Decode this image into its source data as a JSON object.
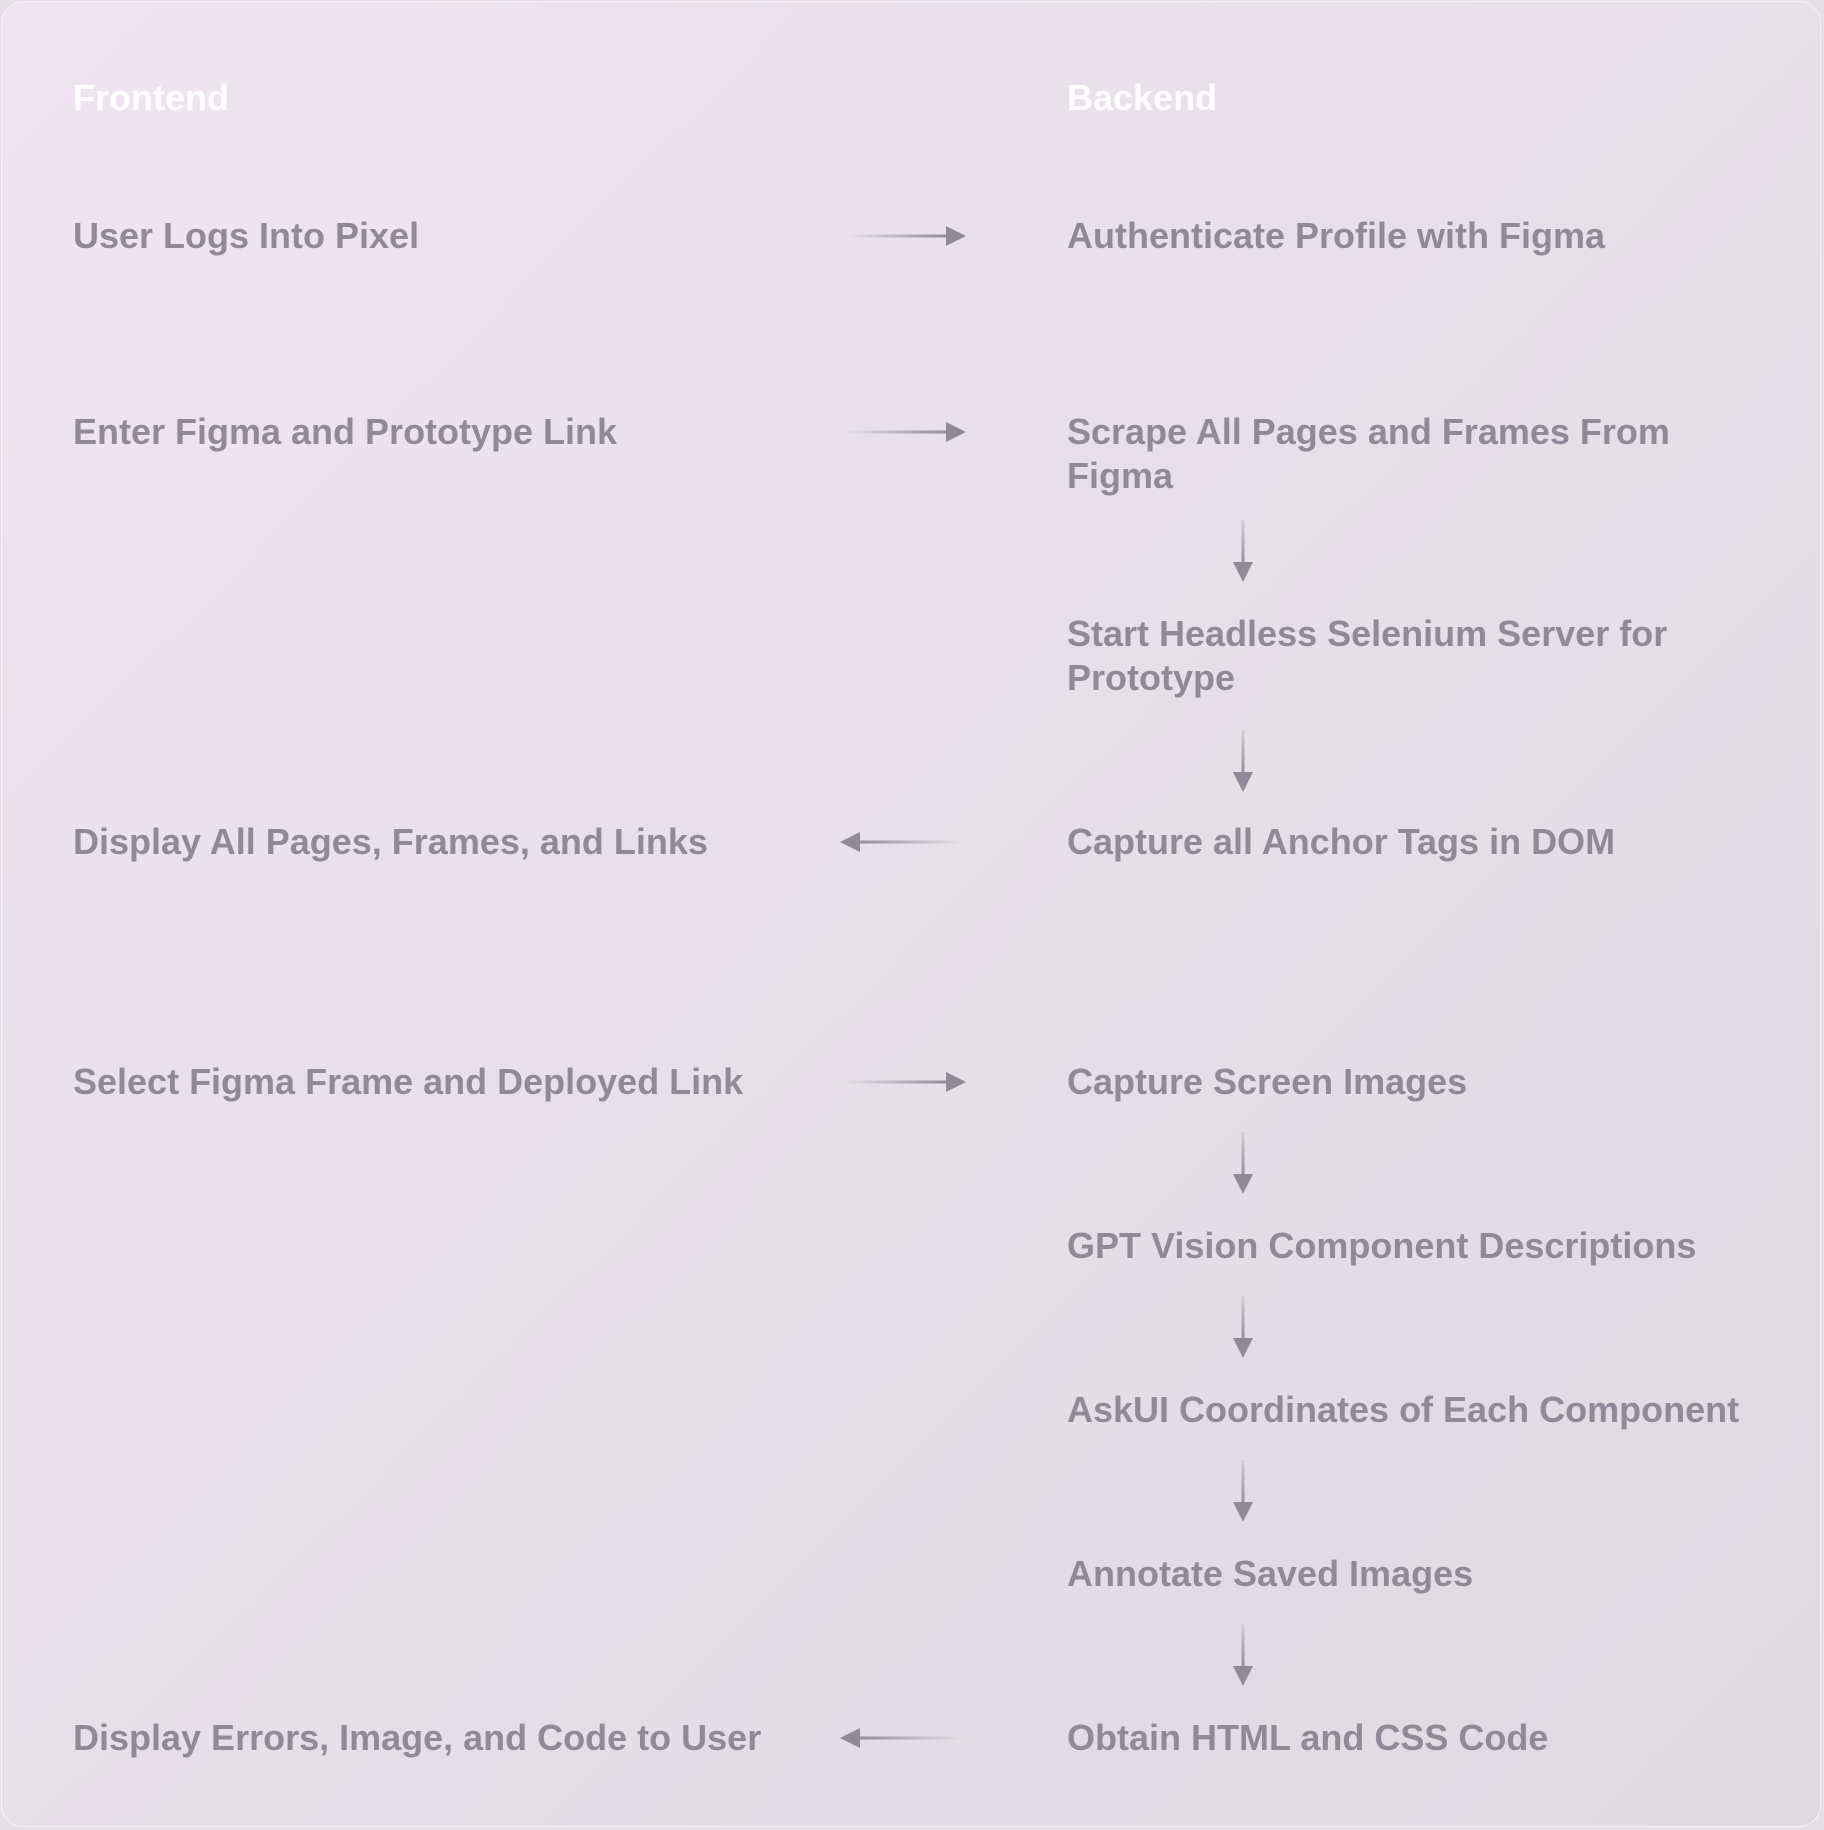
{
  "diagram": {
    "frontend": {
      "header": "Frontend",
      "steps": [
        "User Logs Into Pixel",
        "Enter Figma and Prototype Link",
        "Display All Pages, Frames, and Links",
        "Select Figma Frame and Deployed Link",
        "Display Errors, Image, and Code to User"
      ]
    },
    "backend": {
      "header": "Backend",
      "steps": [
        "Authenticate Profile with Figma",
        "Scrape All Pages and Frames From Figma",
        "Start Headless Selenium Server for Prototype",
        "Capture all Anchor Tags in DOM",
        "Capture Screen Images",
        "GPT Vision Component Descriptions",
        "AskUI Coordinates of Each Component",
        "Annotate Saved Images",
        "Obtain HTML and CSS Code"
      ]
    },
    "connections": [
      {
        "from": "User Logs Into Pixel",
        "to": "Authenticate Profile with Figma",
        "direction": "frontend-to-backend"
      },
      {
        "from": "Enter Figma and Prototype Link",
        "to": "Scrape All Pages and Frames From Figma",
        "direction": "frontend-to-backend"
      },
      {
        "from": "Scrape All Pages and Frames From Figma",
        "to": "Start Headless Selenium Server for Prototype",
        "direction": "down"
      },
      {
        "from": "Start Headless Selenium Server for Prototype",
        "to": "Capture all Anchor Tags in DOM",
        "direction": "down"
      },
      {
        "from": "Capture all Anchor Tags in DOM",
        "to": "Display All Pages, Frames, and Links",
        "direction": "backend-to-frontend"
      },
      {
        "from": "Select Figma Frame and Deployed Link",
        "to": "Capture Screen Images",
        "direction": "frontend-to-backend"
      },
      {
        "from": "Capture Screen Images",
        "to": "GPT Vision Component Descriptions",
        "direction": "down"
      },
      {
        "from": "GPT Vision Component Descriptions",
        "to": "AskUI Coordinates of Each Component",
        "direction": "down"
      },
      {
        "from": "AskUI Coordinates of Each Component",
        "to": "Annotate Saved Images",
        "direction": "down"
      },
      {
        "from": "Annotate Saved Images",
        "to": "Obtain HTML and CSS Code",
        "direction": "down"
      },
      {
        "from": "Obtain HTML and CSS Code",
        "to": "Display Errors, Image, and Code to User",
        "direction": "backend-to-frontend"
      }
    ],
    "colors": {
      "header_text": "#ffffff",
      "step_text": "#8f8a96",
      "arrow": "#8f8a96"
    }
  }
}
